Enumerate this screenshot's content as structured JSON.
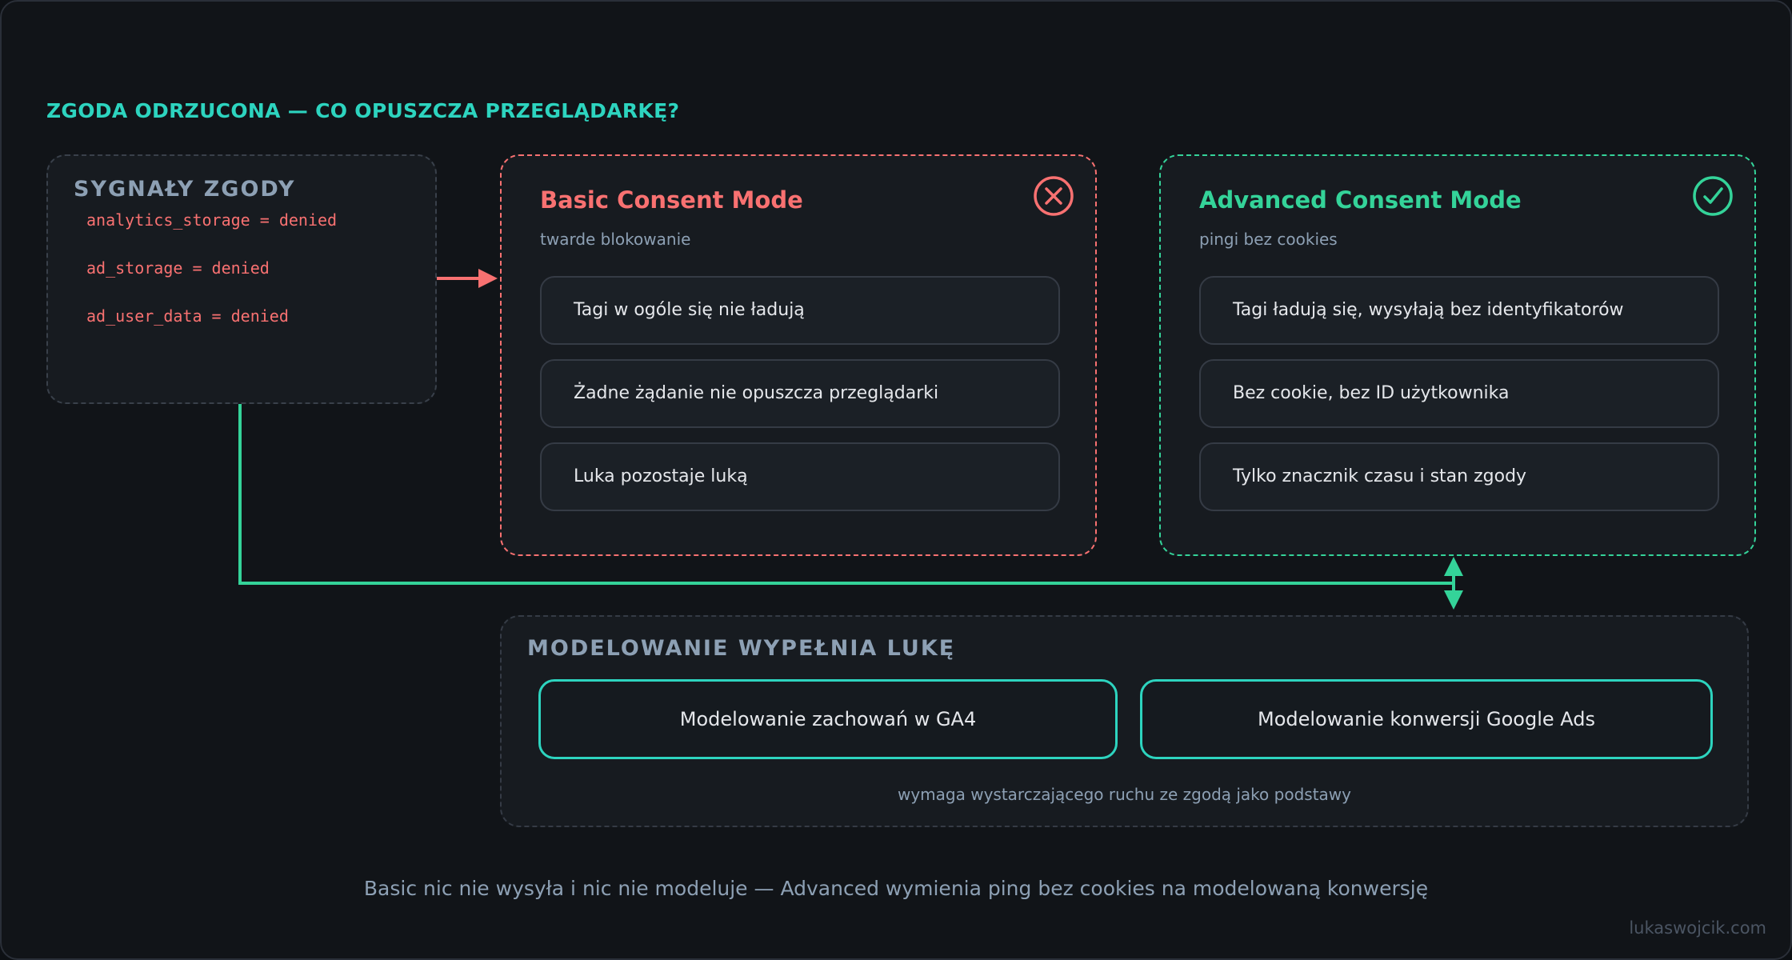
{
  "heading": "ZGODA ODRZUCONA — CO OPUSZCZA PRZEGLĄDARKĘ?",
  "signals": {
    "title": "SYGNAŁY ZGODY",
    "items": [
      "analytics_storage = denied",
      "ad_storage = denied",
      "ad_user_data = denied"
    ]
  },
  "basic": {
    "title": "Basic Consent Mode",
    "subtitle": "twarde blokowanie",
    "icon": "x-circle-icon",
    "items": [
      "Tagi w ogóle się nie ładują",
      "Żadne żądanie nie opuszcza przeglądarki",
      "Luka pozostaje luką"
    ]
  },
  "advanced": {
    "title": "Advanced Consent Mode",
    "subtitle": "pingi bez cookies",
    "icon": "check-circle-icon",
    "items": [
      "Tagi ładują się, wysyłają bez identyfikatorów",
      "Bez cookie, bez ID użytkownika",
      "Tylko znacznik czasu i stan zgody"
    ]
  },
  "modeling": {
    "title": "MODELOWANIE WYPEŁNIA LUKĘ",
    "cards": [
      "Modelowanie zachowań w GA4",
      "Modelowanie konwersji Google Ads"
    ],
    "note": "wymaga wystarczającego ruchu ze zgodą jako podstawy"
  },
  "caption": "Basic nic nie wysyła i nic nie modeluje — Advanced wymienia ping bez cookies na modelowaną konwersję",
  "credit": "lukaswojcik.com",
  "colors": {
    "accent_teal": "#2dd4bf",
    "denied_red": "#f87171",
    "advanced_green": "#34d399",
    "muted": "#8da0b4",
    "background": "#111418"
  }
}
